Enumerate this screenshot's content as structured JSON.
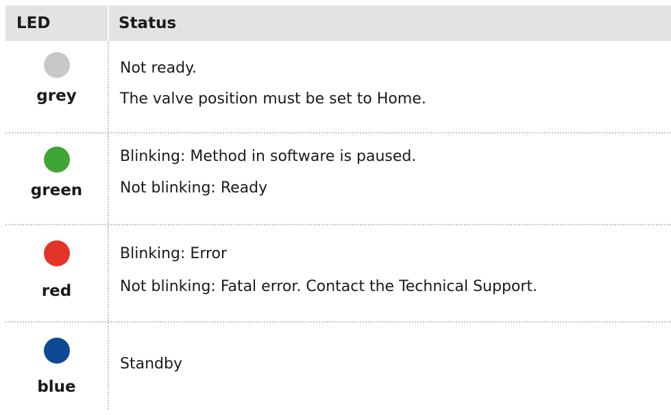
{
  "header": {
    "led": "LED",
    "status": "Status"
  },
  "rows": [
    {
      "name": "grey",
      "color": "#c8c8c8",
      "lines": [
        "Not ready.",
        "The valve position must be set to Home."
      ]
    },
    {
      "name": "green",
      "color": "#3fa535",
      "lines": [
        "Blinking: Method in software is paused.",
        "Not blinking: Ready"
      ]
    },
    {
      "name": "red",
      "color": "#e3342a",
      "lines": [
        "Blinking: Error",
        "Not blinking: Fatal error. Contact the Technical Support."
      ]
    },
    {
      "name": "blue",
      "color": "#0e4a94",
      "lines": [
        "Standby"
      ]
    }
  ]
}
